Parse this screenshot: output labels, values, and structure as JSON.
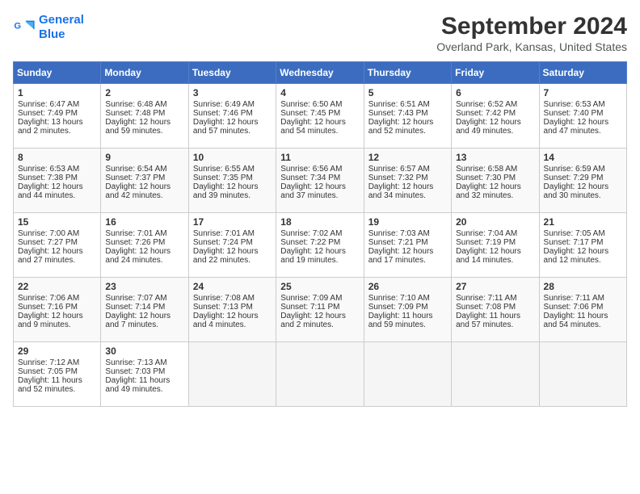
{
  "header": {
    "logo_line1": "General",
    "logo_line2": "Blue",
    "month_year": "September 2024",
    "location": "Overland Park, Kansas, United States"
  },
  "weekdays": [
    "Sunday",
    "Monday",
    "Tuesday",
    "Wednesday",
    "Thursday",
    "Friday",
    "Saturday"
  ],
  "weeks": [
    [
      {
        "day": "1",
        "sunrise": "6:47 AM",
        "sunset": "7:49 PM",
        "daylight": "13 hours and 2 minutes."
      },
      {
        "day": "2",
        "sunrise": "6:48 AM",
        "sunset": "7:48 PM",
        "daylight": "12 hours and 59 minutes."
      },
      {
        "day": "3",
        "sunrise": "6:49 AM",
        "sunset": "7:46 PM",
        "daylight": "12 hours and 57 minutes."
      },
      {
        "day": "4",
        "sunrise": "6:50 AM",
        "sunset": "7:45 PM",
        "daylight": "12 hours and 54 minutes."
      },
      {
        "day": "5",
        "sunrise": "6:51 AM",
        "sunset": "7:43 PM",
        "daylight": "12 hours and 52 minutes."
      },
      {
        "day": "6",
        "sunrise": "6:52 AM",
        "sunset": "7:42 PM",
        "daylight": "12 hours and 49 minutes."
      },
      {
        "day": "7",
        "sunrise": "6:53 AM",
        "sunset": "7:40 PM",
        "daylight": "12 hours and 47 minutes."
      }
    ],
    [
      {
        "day": "8",
        "sunrise": "6:53 AM",
        "sunset": "7:38 PM",
        "daylight": "12 hours and 44 minutes."
      },
      {
        "day": "9",
        "sunrise": "6:54 AM",
        "sunset": "7:37 PM",
        "daylight": "12 hours and 42 minutes."
      },
      {
        "day": "10",
        "sunrise": "6:55 AM",
        "sunset": "7:35 PM",
        "daylight": "12 hours and 39 minutes."
      },
      {
        "day": "11",
        "sunrise": "6:56 AM",
        "sunset": "7:34 PM",
        "daylight": "12 hours and 37 minutes."
      },
      {
        "day": "12",
        "sunrise": "6:57 AM",
        "sunset": "7:32 PM",
        "daylight": "12 hours and 34 minutes."
      },
      {
        "day": "13",
        "sunrise": "6:58 AM",
        "sunset": "7:30 PM",
        "daylight": "12 hours and 32 minutes."
      },
      {
        "day": "14",
        "sunrise": "6:59 AM",
        "sunset": "7:29 PM",
        "daylight": "12 hours and 30 minutes."
      }
    ],
    [
      {
        "day": "15",
        "sunrise": "7:00 AM",
        "sunset": "7:27 PM",
        "daylight": "12 hours and 27 minutes."
      },
      {
        "day": "16",
        "sunrise": "7:01 AM",
        "sunset": "7:26 PM",
        "daylight": "12 hours and 24 minutes."
      },
      {
        "day": "17",
        "sunrise": "7:01 AM",
        "sunset": "7:24 PM",
        "daylight": "12 hours and 22 minutes."
      },
      {
        "day": "18",
        "sunrise": "7:02 AM",
        "sunset": "7:22 PM",
        "daylight": "12 hours and 19 minutes."
      },
      {
        "day": "19",
        "sunrise": "7:03 AM",
        "sunset": "7:21 PM",
        "daylight": "12 hours and 17 minutes."
      },
      {
        "day": "20",
        "sunrise": "7:04 AM",
        "sunset": "7:19 PM",
        "daylight": "12 hours and 14 minutes."
      },
      {
        "day": "21",
        "sunrise": "7:05 AM",
        "sunset": "7:17 PM",
        "daylight": "12 hours and 12 minutes."
      }
    ],
    [
      {
        "day": "22",
        "sunrise": "7:06 AM",
        "sunset": "7:16 PM",
        "daylight": "12 hours and 9 minutes."
      },
      {
        "day": "23",
        "sunrise": "7:07 AM",
        "sunset": "7:14 PM",
        "daylight": "12 hours and 7 minutes."
      },
      {
        "day": "24",
        "sunrise": "7:08 AM",
        "sunset": "7:13 PM",
        "daylight": "12 hours and 4 minutes."
      },
      {
        "day": "25",
        "sunrise": "7:09 AM",
        "sunset": "7:11 PM",
        "daylight": "12 hours and 2 minutes."
      },
      {
        "day": "26",
        "sunrise": "7:10 AM",
        "sunset": "7:09 PM",
        "daylight": "11 hours and 59 minutes."
      },
      {
        "day": "27",
        "sunrise": "7:11 AM",
        "sunset": "7:08 PM",
        "daylight": "11 hours and 57 minutes."
      },
      {
        "day": "28",
        "sunrise": "7:11 AM",
        "sunset": "7:06 PM",
        "daylight": "11 hours and 54 minutes."
      }
    ],
    [
      {
        "day": "29",
        "sunrise": "7:12 AM",
        "sunset": "7:05 PM",
        "daylight": "11 hours and 52 minutes."
      },
      {
        "day": "30",
        "sunrise": "7:13 AM",
        "sunset": "7:03 PM",
        "daylight": "11 hours and 49 minutes."
      },
      null,
      null,
      null,
      null,
      null
    ]
  ]
}
